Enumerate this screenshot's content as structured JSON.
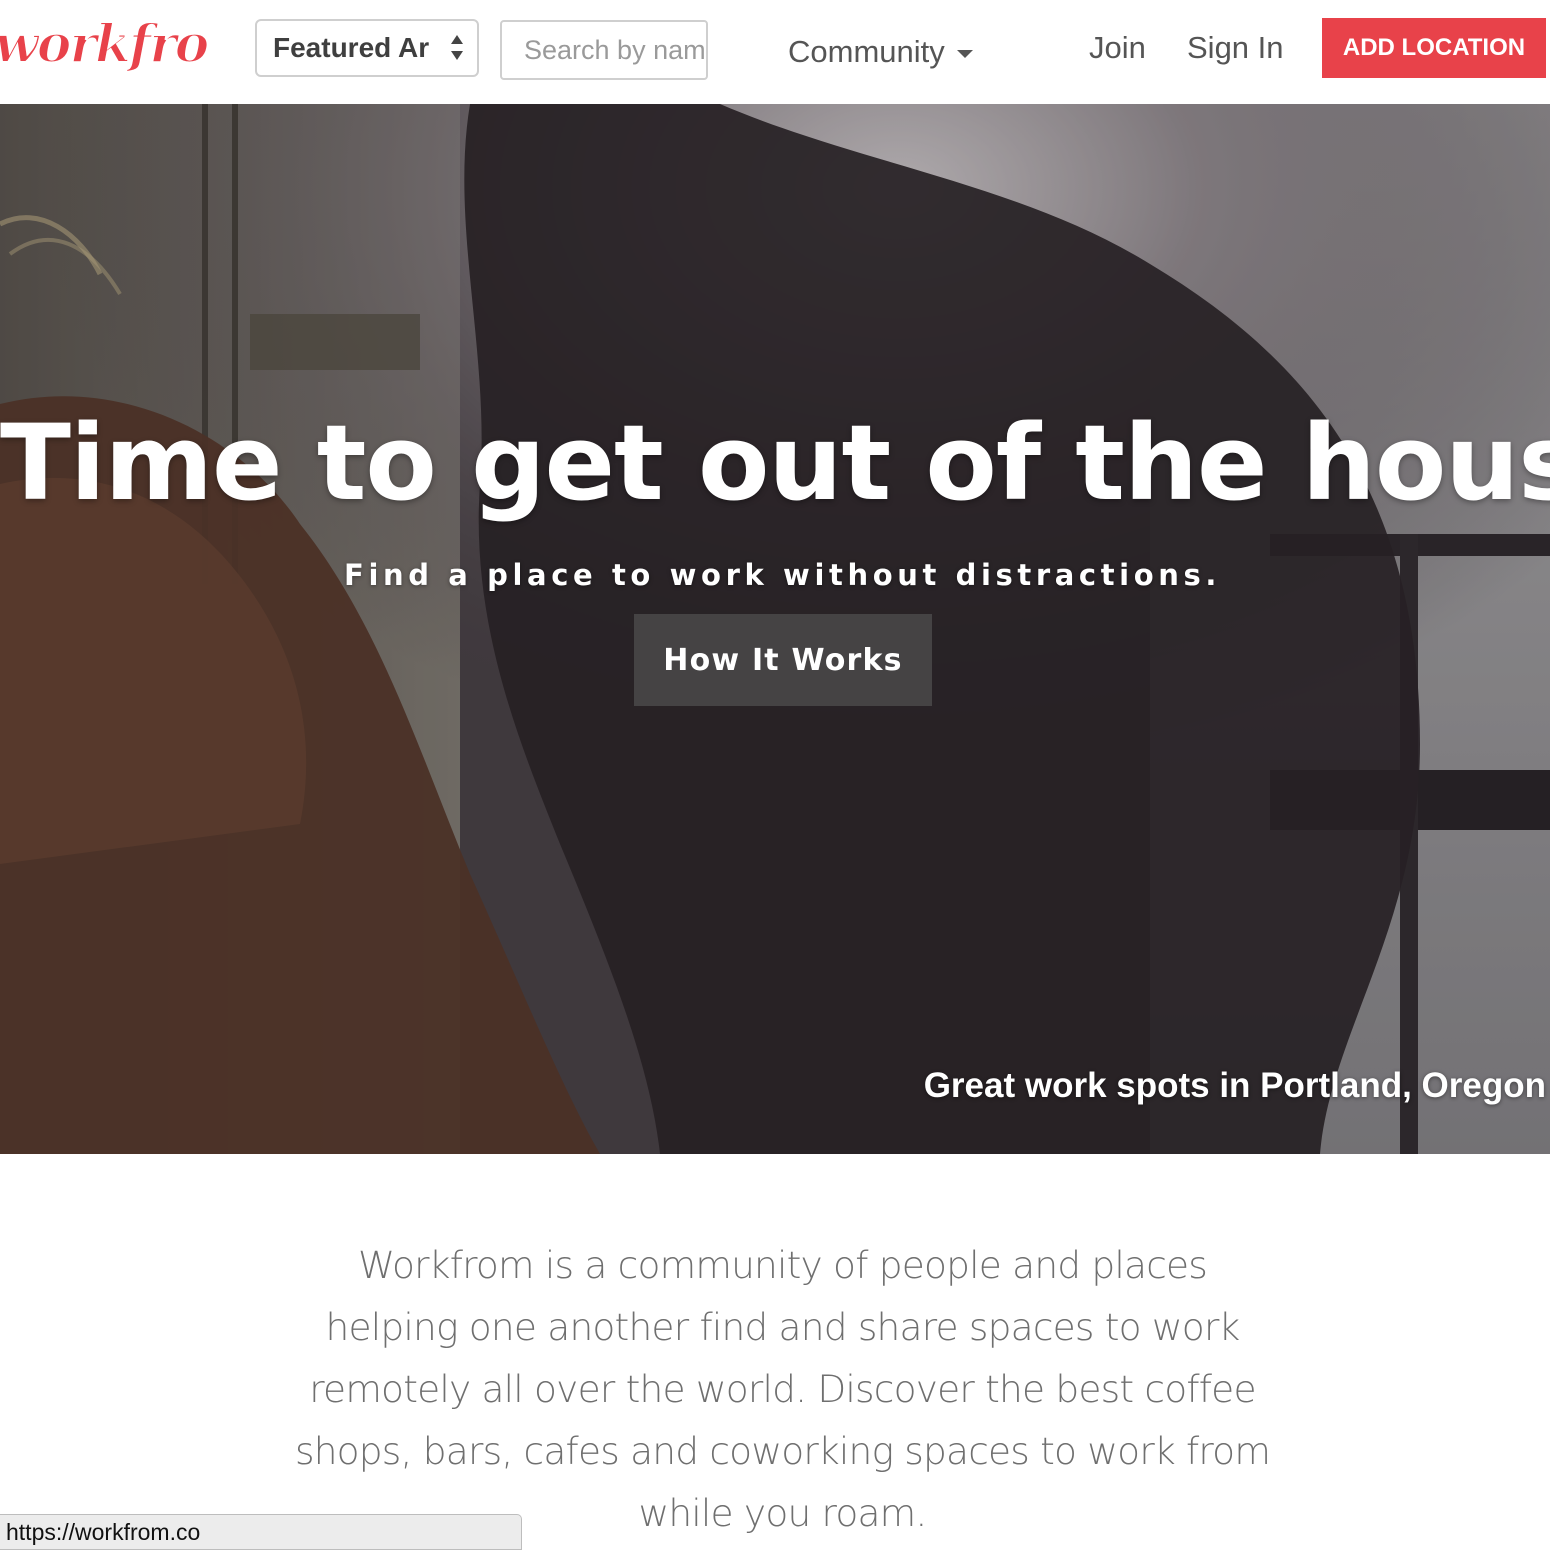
{
  "brand": {
    "logo_text": "workfrom",
    "accent_color": "#e8424a"
  },
  "nav": {
    "area_select": {
      "value": "Featured Areas",
      "visible_text": "Featured Ar"
    },
    "search": {
      "placeholder": "Search by name"
    },
    "community_label": "Community",
    "join_label": "Join",
    "sign_in_label": "Sign In",
    "add_location_label": "ADD LOCATION"
  },
  "hero": {
    "title": "Time to get out of the house.",
    "subtitle": "Find a place to work without distractions.",
    "button_label": "How It Works",
    "caption": "Great work spots in Portland, Oregon"
  },
  "intro": {
    "lines": [
      "Workfrom is a community of people and places",
      "helping one another find and share spaces to work",
      "remotely all over the world. Discover the best coffee",
      "shops, bars, cafes and coworking spaces to work from",
      "while you roam."
    ]
  },
  "status_bar": {
    "url": "https://workfrom.co"
  }
}
